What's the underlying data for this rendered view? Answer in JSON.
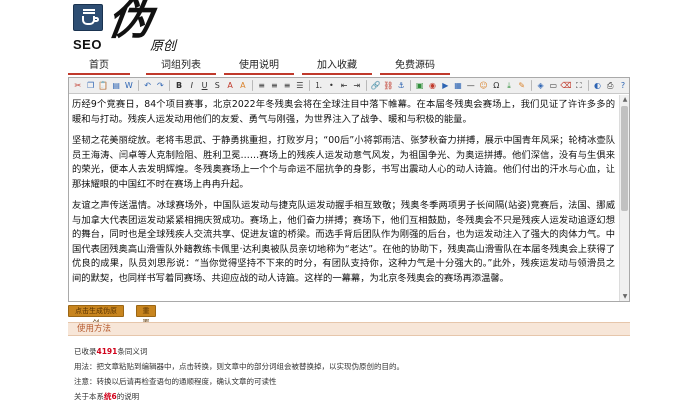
{
  "logo": {
    "brand": "SEO",
    "glyph": "伪",
    "subtitle": "原创"
  },
  "nav": {
    "items": [
      {
        "label": "首页"
      },
      {
        "label": "词组列表"
      },
      {
        "label": "使用说明"
      },
      {
        "label": "加入收藏"
      },
      {
        "label": "免费源码"
      }
    ]
  },
  "toolbar": {
    "icons": [
      {
        "name": "cut-icon",
        "glyph": "✂",
        "color": "tb-red"
      },
      {
        "name": "copy-icon",
        "glyph": "❐",
        "color": "tb-blue"
      },
      {
        "name": "paste-icon",
        "glyph": "📋",
        "color": "tb-orange"
      },
      {
        "name": "paste-text-icon",
        "glyph": "▤",
        "color": "tb-blue"
      },
      {
        "name": "paste-word-icon",
        "glyph": "W",
        "color": "tb-blue"
      },
      {
        "name": "sep"
      },
      {
        "name": "undo-icon",
        "glyph": "↶",
        "color": "tb-blue"
      },
      {
        "name": "redo-icon",
        "glyph": "↷",
        "color": "tb-blue"
      },
      {
        "name": "sep"
      },
      {
        "name": "bold-icon",
        "glyph": "B",
        "color": "tb-bold"
      },
      {
        "name": "italic-icon",
        "glyph": "I",
        "color": "tb-it"
      },
      {
        "name": "underline-icon",
        "glyph": "U",
        "color": "tb-ul"
      },
      {
        "name": "strike-icon",
        "glyph": "S",
        "color": ""
      },
      {
        "name": "font-color-icon",
        "glyph": "A",
        "color": "tb-red"
      },
      {
        "name": "highlight-icon",
        "glyph": "A",
        "color": "tb-orange"
      },
      {
        "name": "sep"
      },
      {
        "name": "align-left-icon",
        "glyph": "≡",
        "color": ""
      },
      {
        "name": "align-center-icon",
        "glyph": "≡",
        "color": ""
      },
      {
        "name": "align-right-icon",
        "glyph": "≡",
        "color": ""
      },
      {
        "name": "justify-icon",
        "glyph": "☰",
        "color": ""
      },
      {
        "name": "sep"
      },
      {
        "name": "ordered-list-icon",
        "glyph": "⒈",
        "color": ""
      },
      {
        "name": "bullet-list-icon",
        "glyph": "•",
        "color": ""
      },
      {
        "name": "outdent-icon",
        "glyph": "⇤",
        "color": ""
      },
      {
        "name": "indent-icon",
        "glyph": "⇥",
        "color": ""
      },
      {
        "name": "sep"
      },
      {
        "name": "link-icon",
        "glyph": "🔗",
        "color": "tb-blue"
      },
      {
        "name": "unlink-icon",
        "glyph": "⛓",
        "color": "tb-red"
      },
      {
        "name": "anchor-icon",
        "glyph": "⚓",
        "color": "tb-blue"
      },
      {
        "name": "sep"
      },
      {
        "name": "image-icon",
        "glyph": "▣",
        "color": "tb-green"
      },
      {
        "name": "flash-icon",
        "glyph": "◉",
        "color": "tb-red"
      },
      {
        "name": "media-icon",
        "glyph": "▶",
        "color": "tb-blue"
      },
      {
        "name": "table-icon",
        "glyph": "▦",
        "color": "tb-blue"
      },
      {
        "name": "hr-icon",
        "glyph": "—",
        "color": ""
      },
      {
        "name": "emoticon-icon",
        "glyph": "☺",
        "color": "tb-orange"
      },
      {
        "name": "special-char-icon",
        "glyph": "Ω",
        "color": ""
      },
      {
        "name": "pagebreak-icon",
        "glyph": "⤓",
        "color": "tb-green"
      },
      {
        "name": "edit-icon",
        "glyph": "✎",
        "color": "tb-orange"
      },
      {
        "name": "sep"
      },
      {
        "name": "source-icon",
        "glyph": "◈",
        "color": "tb-blue"
      },
      {
        "name": "select-all-icon",
        "glyph": "▭",
        "color": ""
      },
      {
        "name": "clear-icon",
        "glyph": "⌫",
        "color": "tb-red"
      },
      {
        "name": "fullscreen-icon",
        "glyph": "⛶",
        "color": ""
      },
      {
        "name": "sep"
      },
      {
        "name": "preview-icon",
        "glyph": "◐",
        "color": "tb-blue"
      },
      {
        "name": "print-icon",
        "glyph": "⎙",
        "color": ""
      },
      {
        "name": "help-icon",
        "glyph": "?",
        "color": "tb-blue"
      }
    ]
  },
  "content": {
    "paragraphs": [
      "历经9个竞赛日，84个项目赛事，北京2022年冬残奥会将在全球注目中落下帷幕。在本届冬残奥会赛场上，我们见证了许许多多的暖和与打动。残疾人运发动用他们的友爱、勇气与刚强，为世界注入了战争、暖和与积极的能量。",
      "坚韧之花美丽绽放。老将韦思武、于静勇挑重担，打败岁月；“00后”小将郭雨洁、张梦秋奋力拼搏，展示中国青年风采；轮椅冰壶队员王海涛、闫卓等人克制险阻、胜利卫冕……赛场上的残疾人运发动意气风发，为祖国争光、为奥运拼搏。他们深信，没有与生俱来的荣光，便本人去发明辉煌。冬残奥赛场上一个个与命运不屈抗争的身影，书写出震动人心的动人诗篇。他们付出的汗水与心血，让那抹耀眼的中国红不时在赛场上冉冉升起。",
      "友谊之声传送温情。冰球赛场外，中国队运发动与捷克队运发动握手相互致敬；残奥冬季两项男子长间隔(站姿)竞赛后，法国、挪威与加拿大代表团运发动紧紧相拥庆贺成功。赛场上，他们奋力拼搏；赛场下，他们互相鼓励，冬残奥会不只是残疾人运发动追逐幻想的舞台，同时也是全球残疾人交流共享、促进友谊的桥梁。而选手背后团队作为刚强的后台，也为运发动注入了强大的肉体力气。中国代表团残奥高山滑雪队外籍教练卡佩里·达利奥被队员亲切地称为“老达”。在他的协助下，残奥高山滑雪队在本届冬残奥会上获得了优良的成果，队员刘思彤说：“当你觉得坚持不下来的时分，有团队支持你，这种力气是十分强大的。”此外，残疾运发动与领滑员之间的默契，也同样书写着同赛场、共迎应战的动人诗篇。这样的一幕幕，为北京冬残奥会的赛场再添温馨。"
    ]
  },
  "actions": {
    "generate_label": "点击生成伪原创",
    "reset_label": "重置"
  },
  "usage": {
    "title": "使用方法",
    "count_prefix": "已收录",
    "count_value": "4191",
    "count_suffix": "条同义词",
    "line1": "用法：把文章粘贴到编辑器中，点击转换，则文章中的部分词组会被替换掉，以实现伪原创的目的。",
    "line2": "注意：转换以后请再检查语句的通顺程度，确认文章的可读性",
    "line3_prefix": "关于本系",
    "line3_hl": "统6",
    "line3_suffix": "的说明"
  },
  "colors": {
    "nav_underline": "#c0392b",
    "button_bg": "#c8851f",
    "usage_title_bg": "#f7e6d8",
    "usage_title_text": "#b55a2e",
    "highlight_red": "#d0021b"
  }
}
